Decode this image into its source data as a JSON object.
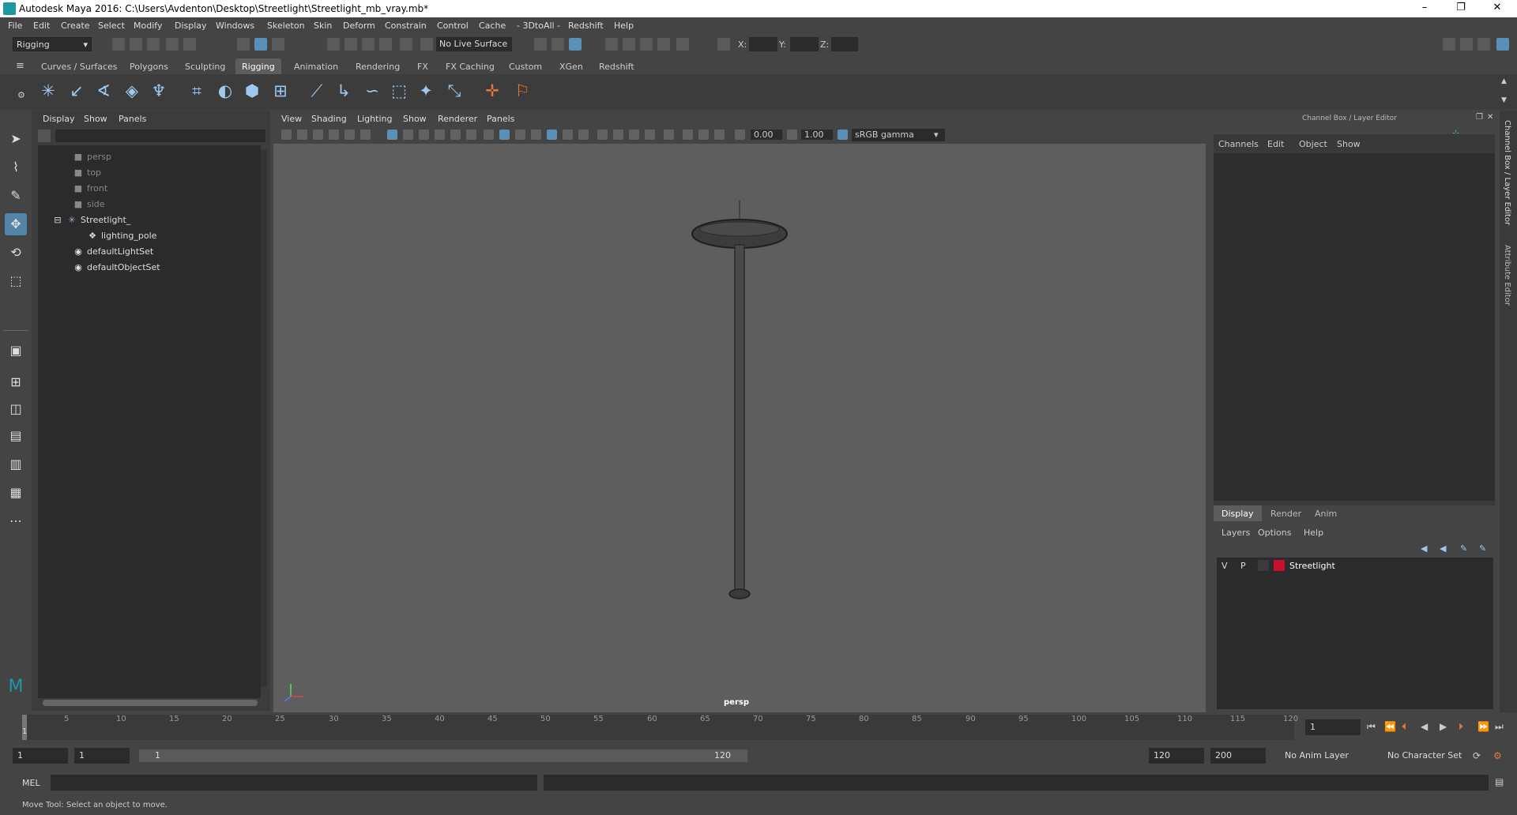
{
  "window": {
    "title": "Autodesk Maya 2016: C:\\Users\\Avdenton\\Desktop\\Streetlight\\Streetlight_mb_vray.mb*",
    "controls": [
      "–",
      "❐",
      "✕"
    ]
  },
  "menubar": [
    "File",
    "Edit",
    "Create",
    "Select",
    "Modify",
    "Display",
    "Windows",
    "Skeleton",
    "Skin",
    "Deform",
    "Constrain",
    "Control",
    "Cache",
    "- 3DtoAll -",
    "Redshift",
    "Help"
  ],
  "statusline": {
    "mode": "Rigging",
    "live_surface": "No Live Surface",
    "x_label": "X:",
    "y_label": "Y:",
    "z_label": "Z:"
  },
  "shelf_tabs": [
    "Curves / Surfaces",
    "Polygons",
    "Sculpting",
    "Rigging",
    "Animation",
    "Rendering",
    "FX",
    "FX Caching",
    "Custom",
    "XGen",
    "Redshift"
  ],
  "shelf_active": "Rigging",
  "outliner": {
    "menu": [
      "Display",
      "Show",
      "Panels"
    ],
    "items": [
      {
        "label": "persp",
        "icon": "camera-icon",
        "dim": true
      },
      {
        "label": "top",
        "icon": "camera-icon",
        "dim": true
      },
      {
        "label": "front",
        "icon": "camera-icon",
        "dim": true
      },
      {
        "label": "side",
        "icon": "camera-icon",
        "dim": true
      },
      {
        "label": "Streetlight_",
        "icon": "joint-icon",
        "dim": false,
        "expanded": true
      },
      {
        "label": "lighting_pole",
        "icon": "mesh-icon",
        "dim": false,
        "child": true
      },
      {
        "label": "defaultLightSet",
        "icon": "set-icon",
        "dim": false
      },
      {
        "label": "defaultObjectSet",
        "icon": "set-icon",
        "dim": false
      }
    ]
  },
  "viewport": {
    "menu": [
      "View",
      "Shading",
      "Lighting",
      "Show",
      "Renderer",
      "Panels"
    ],
    "exposure": "0.00",
    "gamma": "1.00",
    "color_space": "sRGB gamma",
    "camera_label": "persp"
  },
  "channel_box": {
    "title": "Channel Box / Layer Editor",
    "menu": [
      "Channels",
      "Edit",
      "Object",
      "Show"
    ]
  },
  "layer_editor": {
    "tabs": [
      "Display",
      "Render",
      "Anim"
    ],
    "active_tab": "Display",
    "menu": [
      "Layers",
      "Options",
      "Help"
    ],
    "layers": [
      {
        "v": "V",
        "p": "P",
        "name": "Streetlight",
        "color": "#c8102e"
      }
    ]
  },
  "side_tabs": [
    "Channel Box / Layer Editor",
    "Attribute Editor"
  ],
  "timeline": {
    "ticks": [
      "1",
      "5",
      "10",
      "15",
      "20",
      "25",
      "30",
      "35",
      "40",
      "45",
      "50",
      "55",
      "60",
      "65",
      "70",
      "75",
      "80",
      "85",
      "90",
      "95",
      "100",
      "105",
      "110",
      "115",
      "120"
    ],
    "current_frame": "1"
  },
  "range": {
    "start": "1",
    "playback_start": "1",
    "slider_start": "1",
    "slider_end": "120",
    "playback_end": "120",
    "end": "200",
    "anim_layer": "No Anim Layer",
    "character_set": "No Character Set"
  },
  "command": {
    "label": "MEL"
  },
  "help_line": "Move Tool: Select an object to move.",
  "colors": {
    "accent": "#5a8fb8",
    "layer_red": "#c8102e",
    "maya_teal": "#1a9aa0"
  }
}
